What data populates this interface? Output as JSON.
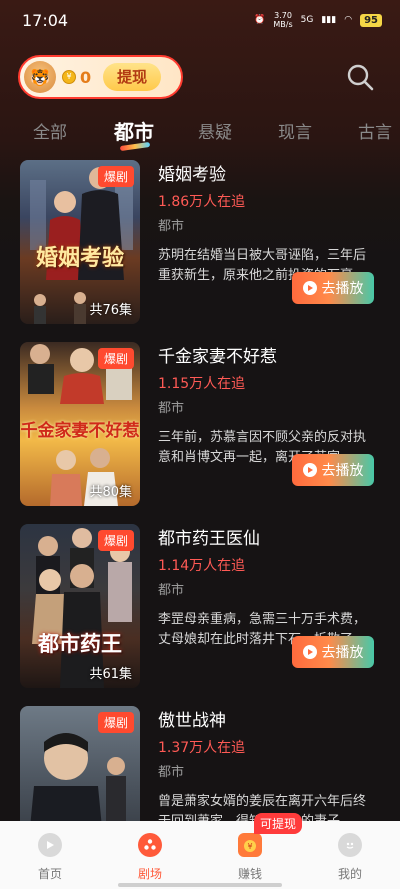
{
  "status_bar": {
    "time": "17:04",
    "speed": "3.70",
    "speed_unit": "MB/s",
    "network": "5G",
    "battery": "95"
  },
  "header": {
    "coins": "0",
    "withdraw_label": "提现"
  },
  "tabs": [
    {
      "label": "全部"
    },
    {
      "label": "都市"
    },
    {
      "label": "悬疑"
    },
    {
      "label": "现言"
    },
    {
      "label": "古言"
    }
  ],
  "dramas": [
    {
      "title": "婚姻考验",
      "followers": "1.86万人在追",
      "genre": "都市",
      "description": "苏明在结婚当日被大哥诬陷，三年后重获新生，原来他之前投资的万豪…",
      "badge": "爆剧",
      "episodes": "共76集",
      "poster_title": "婚姻考验",
      "play_label": "去播放"
    },
    {
      "title": "千金家妻不好惹",
      "followers": "1.15万人在追",
      "genre": "都市",
      "description": "三年前，苏慕言因不顾父亲的反对执意和肖博文再一起，离开了苏家，…",
      "badge": "爆剧",
      "episodes": "共80集",
      "poster_title": "千金家妻不好惹",
      "play_label": "去播放"
    },
    {
      "title": "都市药王医仙",
      "followers": "1.14万人在追",
      "genre": "都市",
      "description": "李罡母亲重病，急需三十万手术费，丈母娘却在此时落井下石，拆散了…",
      "badge": "爆剧",
      "episodes": "共61集",
      "poster_title": "都市药王",
      "play_label": "去播放"
    },
    {
      "title": "傲世战神",
      "followers": "1.37万人在追",
      "genre": "都市",
      "description": "曾是萧家女婿的姜辰在离开六年后终于回到萧家，得知了自己的妻子、…",
      "badge": "爆剧",
      "episodes": "",
      "poster_title": "",
      "play_label": "去播放"
    }
  ],
  "bottom_nav": [
    {
      "label": "首页"
    },
    {
      "label": "剧场"
    },
    {
      "label": "赚钱"
    },
    {
      "label": "我的"
    }
  ],
  "earn_badge": "可提现"
}
